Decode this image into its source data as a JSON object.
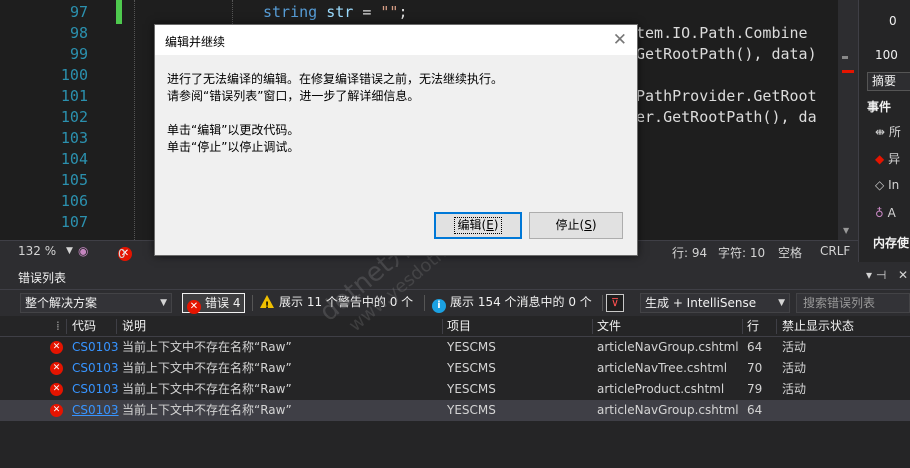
{
  "editor": {
    "line_numbers": [
      "97",
      "98",
      "99",
      "100",
      "101",
      "102",
      "103",
      "104",
      "105",
      "106",
      "107"
    ],
    "line97": {
      "kw": "string",
      "id": "str",
      "eq": " = ",
      "str": "\"\"",
      "end": ";"
    },
    "line98": "tem.IO.Path.Combine",
    "line99": "GetRootPath(), data)",
    "line101": "PathProvider.GetRoot",
    "line102": "er.GetRootPath(), da",
    "zoom": "132 %",
    "error_count": "0",
    "position": "行: 94",
    "char": "字符: 10",
    "whitespace": "空格",
    "line_ending": "CRLF"
  },
  "right_pane": {
    "num1": "0",
    "num2": "100",
    "tab": "摘要",
    "section": "事件",
    "item1": "所",
    "item2": "异",
    "item3": "In",
    "item4": "A",
    "bottom": "内存使"
  },
  "dialog": {
    "title": "编辑并继续",
    "close": "✕",
    "line1": "进行了无法编译的编辑。在修复编译错误之前，无法继续执行。",
    "line2": "请参阅“错误列表”窗口，进一步了解详细信息。",
    "line3": "单击“编辑”以更改代码。",
    "line4": "单击“停止”以停止调试。",
    "edit_label": "编辑(",
    "edit_key": "E",
    "edit_end": ")",
    "stop_label": "停止(",
    "stop_key": "S",
    "stop_end": ")"
  },
  "error_list": {
    "title": "错误列表",
    "pin": "▾ ⊣",
    "close": "✕",
    "scope": "整个解决方案",
    "errors_btn": "错误 4",
    "warnings_btn": "展示 11 个警告中的 0 个",
    "messages_btn": "展示 154 个消息中的 0 个",
    "build_combo": "生成 + IntelliSense",
    "search_placeholder": "搜索错误列表",
    "columns": {
      "code": "代码",
      "desc": "说明",
      "project": "项目",
      "file": "文件",
      "line": "行",
      "suppress": "禁止显示状态"
    },
    "rows": [
      {
        "code": "CS0103",
        "desc": "当前上下文中不存在名称“Raw”",
        "project": "YESCMS",
        "file": "articleNavGroup.cshtml",
        "line": "64",
        "suppress": "活动"
      },
      {
        "code": "CS0103",
        "desc": "当前上下文中不存在名称“Raw”",
        "project": "YESCMS",
        "file": "articleNavTree.cshtml",
        "line": "70",
        "suppress": "活动"
      },
      {
        "code": "CS0103",
        "desc": "当前上下文中不存在名称“Raw”",
        "project": "YESCMS",
        "file": "articleProduct.cshtml",
        "line": "79",
        "suppress": "活动"
      },
      {
        "code": "CS0103",
        "desc": "当前上下文中不存在名称“Raw”",
        "project": "YESCMS",
        "file": "articleNavGroup.cshtml",
        "line": "64",
        "suppress": ""
      }
    ]
  },
  "watermark": {
    "text1": "dotnet开发框架",
    "text2": "www.yesdotnet.com"
  },
  "colors": {
    "error_red": "#e51400",
    "link_blue": "#3794ff",
    "dialog_bg": "#f0f0f0",
    "accent": "#0078d7"
  }
}
